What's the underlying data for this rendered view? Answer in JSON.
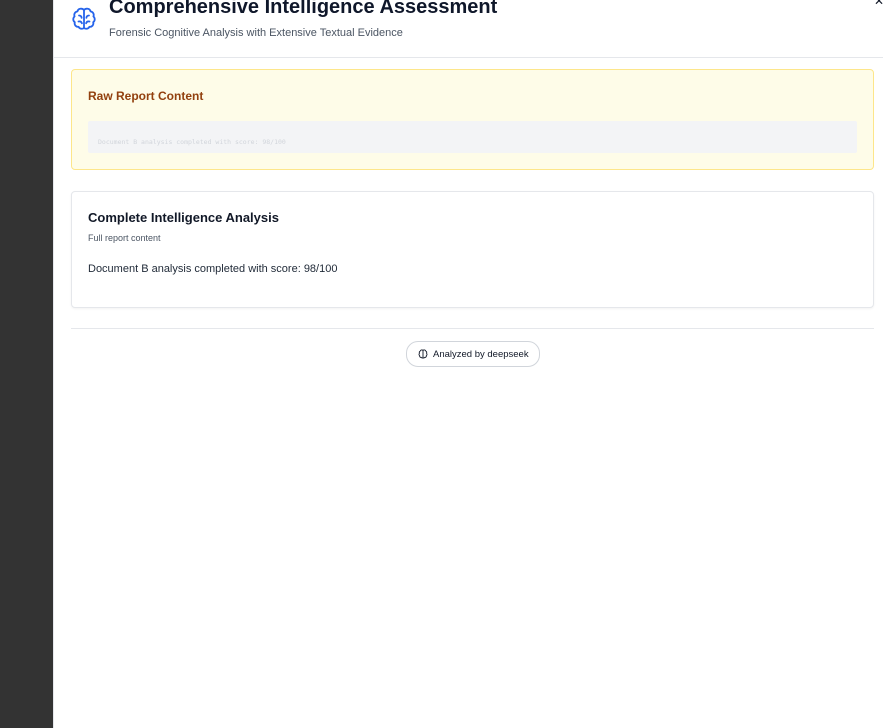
{
  "header": {
    "title": "Comprehensive Intelligence Assessment",
    "subtitle": "Forensic Cognitive Analysis with Extensive Textual Evidence",
    "icon": "brain-icon"
  },
  "raw_report": {
    "title": "Raw Report Content",
    "content": "Document B analysis completed with score: 98/100"
  },
  "analysis": {
    "title": "Complete Intelligence Analysis",
    "subtitle": "Full report content",
    "body": "Document B analysis completed with score: 98/100"
  },
  "footer": {
    "badge_label": "Analyzed by deepseek",
    "badge_icon": "brain-icon"
  },
  "colors": {
    "accent": "#2563eb",
    "raw_card_bg": "#fefce8",
    "raw_card_border": "#fde68a",
    "raw_title": "#92400e",
    "left_rail": "#333333"
  }
}
